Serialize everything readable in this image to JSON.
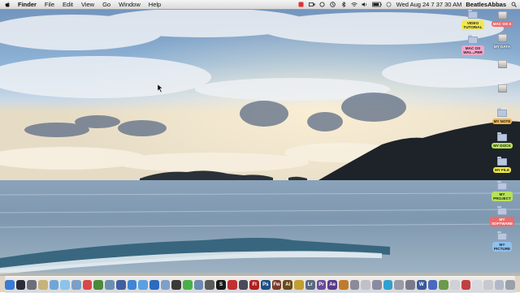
{
  "menubar": {
    "app_name": "Finder",
    "menus": [
      "File",
      "Edit",
      "View",
      "Go",
      "Window",
      "Help"
    ],
    "clock": "Wed Aug 24  7 37 30 AM",
    "user": "BeatlesAbbas"
  },
  "desktop_icons": [
    {
      "label": "VIDEO\nTUTORIAL",
      "kind": "folder",
      "color": "yellow"
    },
    {
      "label": "MAC OS X",
      "kind": "drive",
      "color": "red"
    },
    {
      "label": "MY DATA",
      "kind": "drive",
      "color": "plain"
    },
    {
      "label": "MAC OS\nWAL...PER",
      "kind": "folder",
      "color": "pink"
    },
    {
      "label": "",
      "kind": "drive",
      "color": "plain"
    },
    {
      "label": "",
      "kind": "drive",
      "color": "plain"
    },
    {
      "label": "MY NOTE",
      "kind": "folder",
      "color": "orange"
    },
    {
      "label": "MY DOCK",
      "kind": "folder",
      "color": "green"
    },
    {
      "label": "MY FILE",
      "kind": "folder",
      "color": "yellow"
    },
    {
      "label": "MY\nPROJECT",
      "kind": "folder",
      "color": "green"
    },
    {
      "label": "MY\nSOFTWARE",
      "kind": "folder",
      "color": "red"
    },
    {
      "label": "MY\nPICTURE",
      "kind": "folder",
      "color": "blue"
    }
  ],
  "dock": {
    "items": [
      {
        "name": "finder-icon",
        "color": "#3a7bd5",
        "glyph": ""
      },
      {
        "name": "dashboard-icon",
        "color": "#2b2b3a",
        "glyph": ""
      },
      {
        "name": "launchpad-icon",
        "color": "#6b6f7a",
        "glyph": ""
      },
      {
        "name": "preview-icon",
        "color": "#c7b27a",
        "glyph": ""
      },
      {
        "name": "app-icon",
        "color": "#6fa6d8",
        "glyph": ""
      },
      {
        "name": "app-icon",
        "color": "#8ac4ea",
        "glyph": ""
      },
      {
        "name": "mail-icon",
        "color": "#7aa0c8",
        "glyph": ""
      },
      {
        "name": "app-icon",
        "color": "#d84848",
        "glyph": ""
      },
      {
        "name": "app-icon",
        "color": "#4a8a3a",
        "glyph": ""
      },
      {
        "name": "app-icon",
        "color": "#6b8fb0",
        "glyph": ""
      },
      {
        "name": "app-icon",
        "color": "#4060a0",
        "glyph": ""
      },
      {
        "name": "safari-icon",
        "color": "#3e86d6",
        "glyph": ""
      },
      {
        "name": "app-icon",
        "color": "#5aa0e0",
        "glyph": ""
      },
      {
        "name": "app-icon",
        "color": "#2e6ac0",
        "glyph": ""
      },
      {
        "name": "app-icon",
        "color": "#7ea0c8",
        "glyph": ""
      },
      {
        "name": "app-icon",
        "color": "#3a3a3a",
        "glyph": ""
      },
      {
        "name": "app-icon",
        "color": "#48b048",
        "glyph": ""
      },
      {
        "name": "app-icon",
        "color": "#6a8ab0",
        "glyph": ""
      },
      {
        "name": "app-icon",
        "color": "#5a5a5a",
        "glyph": ""
      },
      {
        "name": "app-icon",
        "color": "#1a1a1a",
        "glyph": "S"
      },
      {
        "name": "app-icon",
        "color": "#c03030",
        "glyph": ""
      },
      {
        "name": "app-icon",
        "color": "#4a4a5a",
        "glyph": ""
      },
      {
        "name": "flash-icon",
        "color": "#b02020",
        "glyph": "Fl"
      },
      {
        "name": "photoshop-icon",
        "color": "#1e4f8a",
        "glyph": "Ps"
      },
      {
        "name": "fireworks-icon",
        "color": "#7a3a2a",
        "glyph": "Fw"
      },
      {
        "name": "illustrator-icon",
        "color": "#6a4a1a",
        "glyph": "Ai"
      },
      {
        "name": "app-icon",
        "color": "#c0a030",
        "glyph": ""
      },
      {
        "name": "lightroom-icon",
        "color": "#5a6a80",
        "glyph": "Lr"
      },
      {
        "name": "premiere-icon",
        "color": "#6a4a9a",
        "glyph": "Pr"
      },
      {
        "name": "after-effects-icon",
        "color": "#5a3a8a",
        "glyph": "Ae"
      },
      {
        "name": "app-icon",
        "color": "#c07a30",
        "glyph": ""
      },
      {
        "name": "app-icon",
        "color": "#8a8a9a",
        "glyph": ""
      },
      {
        "name": "app-icon",
        "color": "#c0c0c8",
        "glyph": ""
      },
      {
        "name": "app-icon",
        "color": "#8a8aa0",
        "glyph": ""
      },
      {
        "name": "app-icon",
        "color": "#30a0d0",
        "glyph": ""
      },
      {
        "name": "app-icon",
        "color": "#9a9aa8",
        "glyph": ""
      },
      {
        "name": "app-icon",
        "color": "#7a7a8a",
        "glyph": ""
      },
      {
        "name": "app-icon",
        "color": "#3a5a9a",
        "glyph": "W"
      },
      {
        "name": "app-icon",
        "color": "#4a6ac0",
        "glyph": ""
      },
      {
        "name": "app-icon",
        "color": "#6a9a4a",
        "glyph": ""
      },
      {
        "name": "app-icon",
        "color": "#d0d0d8",
        "glyph": ""
      },
      {
        "name": "app-icon",
        "color": "#c04040",
        "glyph": ""
      },
      {
        "name": "app-icon",
        "color": "#d8d8e0",
        "glyph": ""
      },
      {
        "name": "app-icon",
        "color": "#c8c8d0",
        "glyph": ""
      },
      {
        "name": "app-icon",
        "color": "#b0b8c8",
        "glyph": ""
      },
      {
        "name": "trash-icon",
        "color": "#9aa0aa",
        "glyph": ""
      }
    ]
  }
}
